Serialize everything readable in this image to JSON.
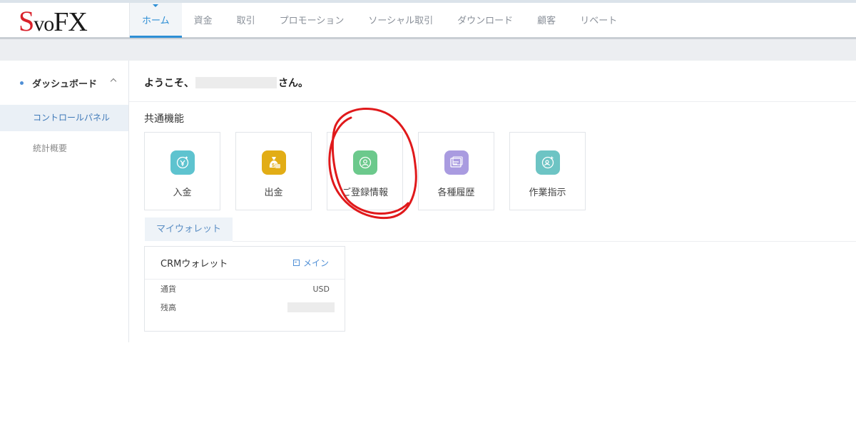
{
  "brand": {
    "logo_s": "S",
    "logo_vo": "vo",
    "logo_fx": "FX"
  },
  "nav": {
    "items": [
      "ホーム",
      "資金",
      "取引",
      "プロモーション",
      "ソーシャル取引",
      "ダウンロード",
      "顧客",
      "リベート"
    ],
    "active": "ホーム"
  },
  "sidebar": {
    "group_label": "ダッシュボード",
    "items": [
      {
        "label": "コントロールパネル",
        "active": true
      },
      {
        "label": "統計概要",
        "active": false
      }
    ]
  },
  "main": {
    "welcome_prefix": "ようこそ、",
    "welcome_suffix": "さん。",
    "section_title": "共通機能",
    "cards": [
      {
        "label": "入金",
        "icon": "deposit-icon",
        "color": "#5ec3cf"
      },
      {
        "label": "出金",
        "icon": "withdraw-money-bag-icon",
        "color": "#e2ad16"
      },
      {
        "label": "ご登録情報",
        "icon": "user-profile-icon",
        "color": "#6cc98c"
      },
      {
        "label": "各種履歴",
        "icon": "history-icon",
        "color": "#a99be0"
      },
      {
        "label": "作業指示",
        "icon": "user-add-icon",
        "color": "#6dc4c4"
      }
    ],
    "wallet_tab": "マイウォレット",
    "wallet": {
      "title": "CRMウォレット",
      "main_label": "メイン",
      "rows": [
        {
          "label": "通貨",
          "value": "USD"
        },
        {
          "label": "残高",
          "value": ""
        }
      ]
    }
  },
  "colors": {
    "accent": "#2e8fd5",
    "logo_red": "#d9212b",
    "annotation_red": "#e0191b"
  }
}
